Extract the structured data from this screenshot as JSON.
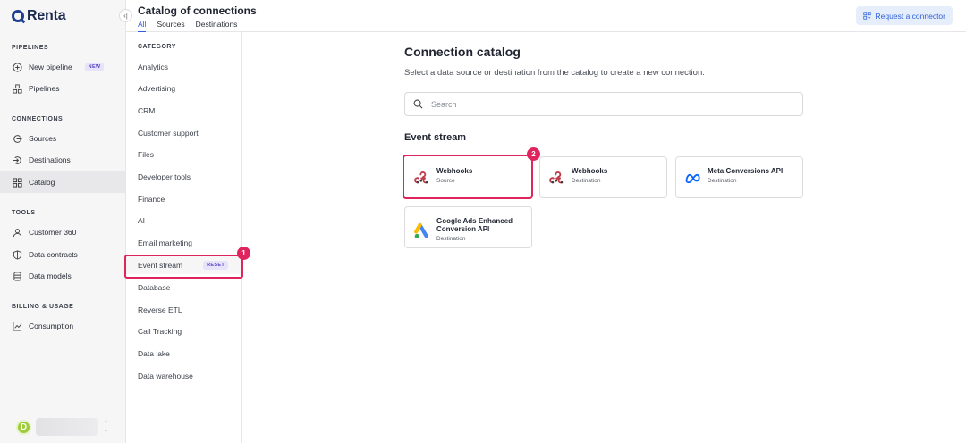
{
  "brand": {
    "name": "Renta"
  },
  "sidebar": {
    "collapse_glyph": "‹|",
    "sections": {
      "pipelines": "PIPELINES",
      "connections": "CONNECTIONS",
      "tools": "TOOLS",
      "billing": "BILLING & USAGE"
    },
    "items": [
      {
        "label": "New pipeline",
        "icon": "plus-circle-icon",
        "badge": "NEW"
      },
      {
        "label": "Pipelines",
        "icon": "pipelines-icon"
      },
      {
        "label": "Sources",
        "icon": "sources-icon"
      },
      {
        "label": "Destinations",
        "icon": "destinations-icon"
      },
      {
        "label": "Catalog",
        "icon": "grid-icon",
        "active": true
      },
      {
        "label": "Customer 360",
        "icon": "user-icon"
      },
      {
        "label": "Data contracts",
        "icon": "shield-icon"
      },
      {
        "label": "Data models",
        "icon": "database-icon"
      },
      {
        "label": "Consumption",
        "icon": "chart-icon"
      }
    ],
    "user": {
      "initial": "D"
    }
  },
  "header": {
    "title": "Catalog of connections",
    "tabs": [
      "All",
      "Sources",
      "Destinations"
    ],
    "active_tab": "All",
    "request_button": "Request a connector"
  },
  "categories": {
    "heading": "CATEGORY",
    "items": [
      "Analytics",
      "Advertising",
      "CRM",
      "Customer support",
      "Files",
      "Developer tools",
      "Finance",
      "AI",
      "Email marketing",
      "Event stream",
      "Database",
      "Reverse ETL",
      "Call Tracking",
      "Data lake",
      "Data warehouse"
    ],
    "selected": "Event stream",
    "reset_label": "RESET"
  },
  "main": {
    "title": "Connection catalog",
    "subtitle": "Select a data source or destination from the catalog to create a new connection.",
    "search_placeholder": "Search",
    "section_title": "Event stream",
    "cards": [
      {
        "name": "Webhooks",
        "type": "Source",
        "logo": "webhook-icon"
      },
      {
        "name": "Webhooks",
        "type": "Destination",
        "logo": "webhook-icon"
      },
      {
        "name": "Meta Conversions API",
        "type": "Destination",
        "logo": "meta-icon"
      },
      {
        "name": "Google Ads Enhanced Conversion API",
        "type": "Destination",
        "logo": "google-ads-icon"
      }
    ]
  },
  "annotations": {
    "marker_1": "1",
    "marker_2": "2"
  },
  "colors": {
    "accent": "#2b5fd9",
    "highlight": "#e0245e",
    "badge_bg": "#e7e3fb",
    "badge_text": "#5b4bc4"
  }
}
